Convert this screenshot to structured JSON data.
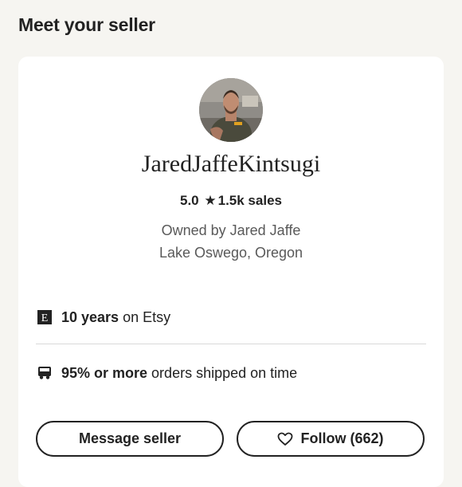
{
  "section": {
    "title": "Meet your seller"
  },
  "seller": {
    "shop_name": "JaredJaffeKintsugi",
    "rating": "5.0",
    "rating_star": "★",
    "sales": "1.5k sales",
    "owner": "Owned by Jared Jaffe",
    "location": "Lake Oswego, Oregon"
  },
  "info": {
    "years_bold": "10 years",
    "years_text": "on Etsy",
    "years_icon": "etsy-e-icon",
    "shipping_bold": "95% or more",
    "shipping_text": "orders shipped on time",
    "shipping_icon": "truck-icon"
  },
  "actions": {
    "message_label": "Message seller",
    "follow_label": "Follow (662)",
    "follow_icon": "heart-icon"
  }
}
